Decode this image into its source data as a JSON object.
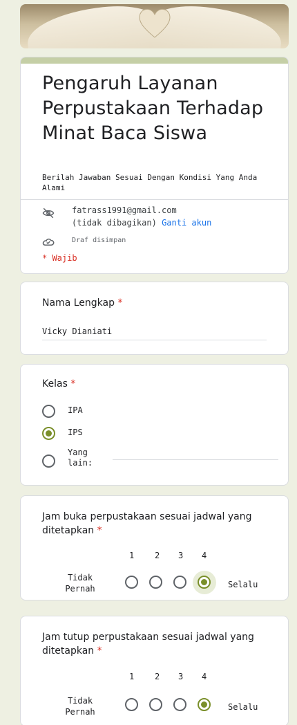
{
  "form": {
    "title": "Pengaruh Layanan Perpustakaan Terhadap Minat Baca Siswa",
    "description": "Berilah Jawaban Sesuai Dengan Kondisi Yang Anda Alami",
    "account_email": "fatrass1991@gmail.com",
    "account_note": "(tidak dibagikan)",
    "switch_account": "Ganti akun",
    "draft_status": "Draf disimpan",
    "required_note": "* Wajib"
  },
  "questions": {
    "name": {
      "title": "Nama Lengkap",
      "value": "Vicky Dianiati"
    },
    "kelas": {
      "title": "Kelas",
      "options": [
        "IPA",
        "IPS",
        "Yang lain:"
      ],
      "selected": "IPS"
    },
    "buka": {
      "title": "Jam buka perpustakaan sesuai jadwal yang ditetapkan",
      "scale": [
        "1",
        "2",
        "3",
        "4"
      ],
      "low_label": "Tidak Pernah",
      "high_label": "Selalu",
      "selected": 4
    },
    "tutup": {
      "title": "Jam tutup perpustakaan sesuai jadwal yang ditetapkan",
      "scale": [
        "1",
        "2",
        "3",
        "4"
      ],
      "low_label": "Tidak Pernah",
      "high_label": "Selalu",
      "selected": 4
    }
  },
  "required_mark": "*",
  "colors": {
    "background": "#eef0e2",
    "accent": "#7a8f2a",
    "header_bar": "#c5cfa6",
    "required": "#d93025",
    "link": "#1a73e8"
  },
  "icons": [
    "visibility-off-icon",
    "cloud-done-icon"
  ]
}
